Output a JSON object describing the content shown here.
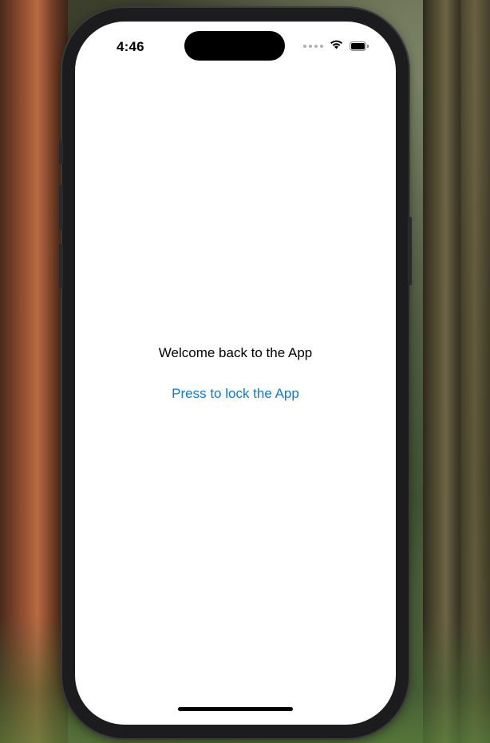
{
  "status_bar": {
    "time": "4:46",
    "wifi_icon": "wifi-icon",
    "battery_icon": "battery-icon",
    "signal_icon": "cellular-signal-icon"
  },
  "main": {
    "welcome_text": "Welcome back to the App",
    "lock_button_label": "Press to lock the App"
  },
  "colors": {
    "accent": "#0a7ad6",
    "background": "#ffffff",
    "text": "#000000"
  }
}
